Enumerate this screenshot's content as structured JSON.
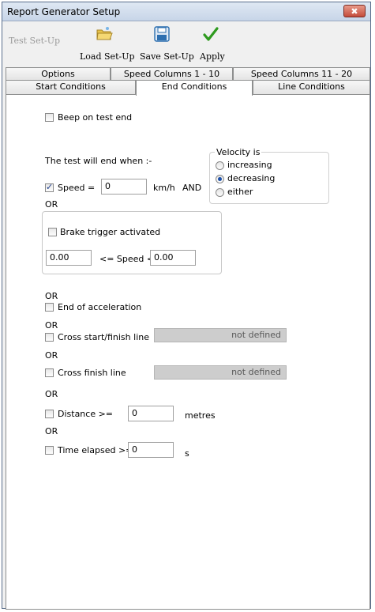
{
  "window": {
    "title": "Report Generator Setup",
    "close_glyph": "✖"
  },
  "toolbar": {
    "test_setup": "Test Set-Up",
    "load_setup": "Load Set-Up",
    "save_setup": "Save Set-Up",
    "apply": "Apply"
  },
  "tabs": {
    "row1": [
      "Options",
      "Speed Columns 1 - 10",
      "Speed Columns 11 - 20"
    ],
    "row2": [
      "Start Conditions",
      "End Conditions",
      "Line Conditions"
    ],
    "active": "End Conditions"
  },
  "end_conditions": {
    "beep": {
      "label": "Beep on test end",
      "checked": false
    },
    "intro": "The test will end when :-",
    "speed": {
      "label": "Speed =",
      "value": "0",
      "unit": "km/h",
      "and": "AND",
      "checked": true
    },
    "velocity": {
      "title": "Velocity is",
      "options": [
        "increasing",
        "decreasing",
        "either"
      ],
      "selected": "decreasing"
    },
    "or": "OR",
    "brake": {
      "label": "Brake trigger activated",
      "checked": false,
      "low": "0.00",
      "high": "0.00",
      "range_label": "<= Speed <"
    },
    "end_accel": {
      "label": "End of acceleration",
      "checked": false
    },
    "cross_start": {
      "label": "Cross start/finish line",
      "checked": false,
      "value": "not defined"
    },
    "cross_finish": {
      "label": "Cross finish line",
      "checked": false,
      "value": "not defined"
    },
    "distance": {
      "label": "Distance >=",
      "checked": false,
      "value": "0",
      "unit": "metres"
    },
    "time": {
      "label": "Time elapsed >=",
      "checked": false,
      "value": "0",
      "unit": "s"
    }
  },
  "colors": {
    "apply_check": "#2e9a1e",
    "save_disk": "#2d6fb0",
    "folder": "#e8c34a"
  }
}
